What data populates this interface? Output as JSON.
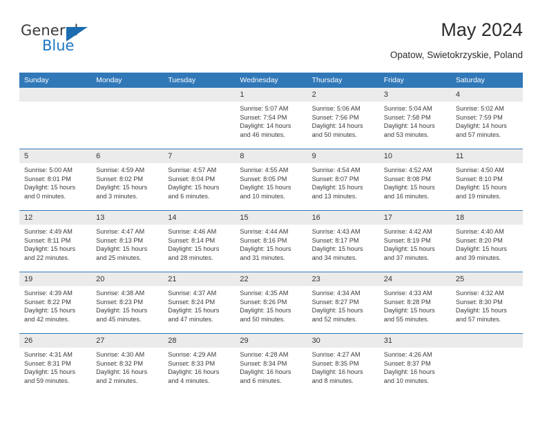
{
  "brand": {
    "word_one": "General",
    "word_two": "Blue",
    "triangle_icon": "triangle-icon",
    "accent_color": "#1b6cb0"
  },
  "header": {
    "title": "May 2024",
    "location": "Opatow, Swietokrzyskie, Poland"
  },
  "theme": {
    "header_blue": "#3178b8",
    "daynum_gray": "#ebebeb",
    "text": "#3a3a3a"
  },
  "weekdays": [
    "Sunday",
    "Monday",
    "Tuesday",
    "Wednesday",
    "Thursday",
    "Friday",
    "Saturday"
  ],
  "weeks": [
    [
      {
        "day": "",
        "sunrise": "",
        "sunset": "",
        "daylight_line1": "",
        "daylight_line2": "",
        "empty": true
      },
      {
        "day": "",
        "sunrise": "",
        "sunset": "",
        "daylight_line1": "",
        "daylight_line2": "",
        "empty": true
      },
      {
        "day": "",
        "sunrise": "",
        "sunset": "",
        "daylight_line1": "",
        "daylight_line2": "",
        "empty": true
      },
      {
        "day": "1",
        "sunrise": "Sunrise: 5:07 AM",
        "sunset": "Sunset: 7:54 PM",
        "daylight_line1": "Daylight: 14 hours",
        "daylight_line2": "and 46 minutes.",
        "empty": false
      },
      {
        "day": "2",
        "sunrise": "Sunrise: 5:06 AM",
        "sunset": "Sunset: 7:56 PM",
        "daylight_line1": "Daylight: 14 hours",
        "daylight_line2": "and 50 minutes.",
        "empty": false
      },
      {
        "day": "3",
        "sunrise": "Sunrise: 5:04 AM",
        "sunset": "Sunset: 7:58 PM",
        "daylight_line1": "Daylight: 14 hours",
        "daylight_line2": "and 53 minutes.",
        "empty": false
      },
      {
        "day": "4",
        "sunrise": "Sunrise: 5:02 AM",
        "sunset": "Sunset: 7:59 PM",
        "daylight_line1": "Daylight: 14 hours",
        "daylight_line2": "and 57 minutes.",
        "empty": false
      }
    ],
    [
      {
        "day": "5",
        "sunrise": "Sunrise: 5:00 AM",
        "sunset": "Sunset: 8:01 PM",
        "daylight_line1": "Daylight: 15 hours",
        "daylight_line2": "and 0 minutes.",
        "empty": false
      },
      {
        "day": "6",
        "sunrise": "Sunrise: 4:59 AM",
        "sunset": "Sunset: 8:02 PM",
        "daylight_line1": "Daylight: 15 hours",
        "daylight_line2": "and 3 minutes.",
        "empty": false
      },
      {
        "day": "7",
        "sunrise": "Sunrise: 4:57 AM",
        "sunset": "Sunset: 8:04 PM",
        "daylight_line1": "Daylight: 15 hours",
        "daylight_line2": "and 6 minutes.",
        "empty": false
      },
      {
        "day": "8",
        "sunrise": "Sunrise: 4:55 AM",
        "sunset": "Sunset: 8:05 PM",
        "daylight_line1": "Daylight: 15 hours",
        "daylight_line2": "and 10 minutes.",
        "empty": false
      },
      {
        "day": "9",
        "sunrise": "Sunrise: 4:54 AM",
        "sunset": "Sunset: 8:07 PM",
        "daylight_line1": "Daylight: 15 hours",
        "daylight_line2": "and 13 minutes.",
        "empty": false
      },
      {
        "day": "10",
        "sunrise": "Sunrise: 4:52 AM",
        "sunset": "Sunset: 8:08 PM",
        "daylight_line1": "Daylight: 15 hours",
        "daylight_line2": "and 16 minutes.",
        "empty": false
      },
      {
        "day": "11",
        "sunrise": "Sunrise: 4:50 AM",
        "sunset": "Sunset: 8:10 PM",
        "daylight_line1": "Daylight: 15 hours",
        "daylight_line2": "and 19 minutes.",
        "empty": false
      }
    ],
    [
      {
        "day": "12",
        "sunrise": "Sunrise: 4:49 AM",
        "sunset": "Sunset: 8:11 PM",
        "daylight_line1": "Daylight: 15 hours",
        "daylight_line2": "and 22 minutes.",
        "empty": false
      },
      {
        "day": "13",
        "sunrise": "Sunrise: 4:47 AM",
        "sunset": "Sunset: 8:13 PM",
        "daylight_line1": "Daylight: 15 hours",
        "daylight_line2": "and 25 minutes.",
        "empty": false
      },
      {
        "day": "14",
        "sunrise": "Sunrise: 4:46 AM",
        "sunset": "Sunset: 8:14 PM",
        "daylight_line1": "Daylight: 15 hours",
        "daylight_line2": "and 28 minutes.",
        "empty": false
      },
      {
        "day": "15",
        "sunrise": "Sunrise: 4:44 AM",
        "sunset": "Sunset: 8:16 PM",
        "daylight_line1": "Daylight: 15 hours",
        "daylight_line2": "and 31 minutes.",
        "empty": false
      },
      {
        "day": "16",
        "sunrise": "Sunrise: 4:43 AM",
        "sunset": "Sunset: 8:17 PM",
        "daylight_line1": "Daylight: 15 hours",
        "daylight_line2": "and 34 minutes.",
        "empty": false
      },
      {
        "day": "17",
        "sunrise": "Sunrise: 4:42 AM",
        "sunset": "Sunset: 8:19 PM",
        "daylight_line1": "Daylight: 15 hours",
        "daylight_line2": "and 37 minutes.",
        "empty": false
      },
      {
        "day": "18",
        "sunrise": "Sunrise: 4:40 AM",
        "sunset": "Sunset: 8:20 PM",
        "daylight_line1": "Daylight: 15 hours",
        "daylight_line2": "and 39 minutes.",
        "empty": false
      }
    ],
    [
      {
        "day": "19",
        "sunrise": "Sunrise: 4:39 AM",
        "sunset": "Sunset: 8:22 PM",
        "daylight_line1": "Daylight: 15 hours",
        "daylight_line2": "and 42 minutes.",
        "empty": false
      },
      {
        "day": "20",
        "sunrise": "Sunrise: 4:38 AM",
        "sunset": "Sunset: 8:23 PM",
        "daylight_line1": "Daylight: 15 hours",
        "daylight_line2": "and 45 minutes.",
        "empty": false
      },
      {
        "day": "21",
        "sunrise": "Sunrise: 4:37 AM",
        "sunset": "Sunset: 8:24 PM",
        "daylight_line1": "Daylight: 15 hours",
        "daylight_line2": "and 47 minutes.",
        "empty": false
      },
      {
        "day": "22",
        "sunrise": "Sunrise: 4:35 AM",
        "sunset": "Sunset: 8:26 PM",
        "daylight_line1": "Daylight: 15 hours",
        "daylight_line2": "and 50 minutes.",
        "empty": false
      },
      {
        "day": "23",
        "sunrise": "Sunrise: 4:34 AM",
        "sunset": "Sunset: 8:27 PM",
        "daylight_line1": "Daylight: 15 hours",
        "daylight_line2": "and 52 minutes.",
        "empty": false
      },
      {
        "day": "24",
        "sunrise": "Sunrise: 4:33 AM",
        "sunset": "Sunset: 8:28 PM",
        "daylight_line1": "Daylight: 15 hours",
        "daylight_line2": "and 55 minutes.",
        "empty": false
      },
      {
        "day": "25",
        "sunrise": "Sunrise: 4:32 AM",
        "sunset": "Sunset: 8:30 PM",
        "daylight_line1": "Daylight: 15 hours",
        "daylight_line2": "and 57 minutes.",
        "empty": false
      }
    ],
    [
      {
        "day": "26",
        "sunrise": "Sunrise: 4:31 AM",
        "sunset": "Sunset: 8:31 PM",
        "daylight_line1": "Daylight: 15 hours",
        "daylight_line2": "and 59 minutes.",
        "empty": false
      },
      {
        "day": "27",
        "sunrise": "Sunrise: 4:30 AM",
        "sunset": "Sunset: 8:32 PM",
        "daylight_line1": "Daylight: 16 hours",
        "daylight_line2": "and 2 minutes.",
        "empty": false
      },
      {
        "day": "28",
        "sunrise": "Sunrise: 4:29 AM",
        "sunset": "Sunset: 8:33 PM",
        "daylight_line1": "Daylight: 16 hours",
        "daylight_line2": "and 4 minutes.",
        "empty": false
      },
      {
        "day": "29",
        "sunrise": "Sunrise: 4:28 AM",
        "sunset": "Sunset: 8:34 PM",
        "daylight_line1": "Daylight: 16 hours",
        "daylight_line2": "and 6 minutes.",
        "empty": false
      },
      {
        "day": "30",
        "sunrise": "Sunrise: 4:27 AM",
        "sunset": "Sunset: 8:35 PM",
        "daylight_line1": "Daylight: 16 hours",
        "daylight_line2": "and 8 minutes.",
        "empty": false
      },
      {
        "day": "31",
        "sunrise": "Sunrise: 4:26 AM",
        "sunset": "Sunset: 8:37 PM",
        "daylight_line1": "Daylight: 16 hours",
        "daylight_line2": "and 10 minutes.",
        "empty": false
      },
      {
        "day": "",
        "sunrise": "",
        "sunset": "",
        "daylight_line1": "",
        "daylight_line2": "",
        "empty": true
      }
    ]
  ]
}
